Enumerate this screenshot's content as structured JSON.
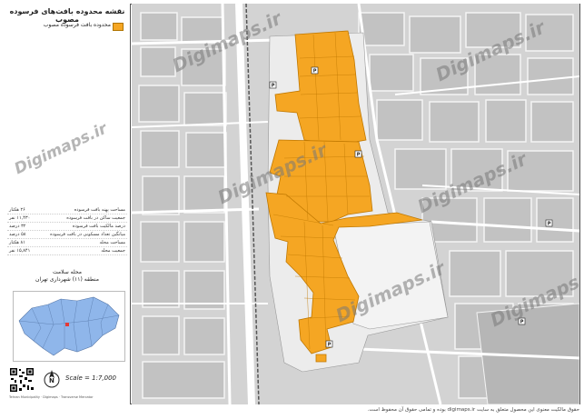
{
  "title": "نقشه محدوده بافت‌های فرسوده مصوب",
  "legend": {
    "label": "محدوده بافت فرسوده مصوب",
    "color": "#f5a623"
  },
  "stats": [
    {
      "label": "مساحت پهنه بافت فرسوده",
      "value": "۲۶ هکتار"
    },
    {
      "label": "جمعیت ساکن در بافت فرسوده",
      "value": "۱۱,۴۳۰ نفر"
    },
    {
      "label": "درصد مالکیت بافت فرسوده",
      "value": "۳۲ درصد"
    },
    {
      "label": "میانگین تعداد مسکونی در بافت فرسوده",
      "value": "۵۸ درصد"
    },
    {
      "label": "مساحت محله",
      "value": "۸۱ هکتار"
    },
    {
      "label": "جمعیت محله",
      "value": "۱۵,۸۴۱ نفر"
    }
  ],
  "district": {
    "neighborhood": "محله سلامت",
    "region": "منطقه (۱۱) شهرداری تهران"
  },
  "scale": "Scale = 1:7,000",
  "north_label": "N",
  "watermark": "Digimaps.ir",
  "footnote_small": "Tehran Municipality · Digimaps · Transverse Mercator",
  "footer": "حقوق مالکیت معنوی این محصول متعلق به سایت digimaps.ir بوده و تمامی حقوق آن محفوظ است.",
  "colors": {
    "zone": "#f5a623",
    "zone_border": "#c07800",
    "road": "#ffffff",
    "block": "#bdbdbd",
    "district_fill": "#8fb6ea"
  }
}
